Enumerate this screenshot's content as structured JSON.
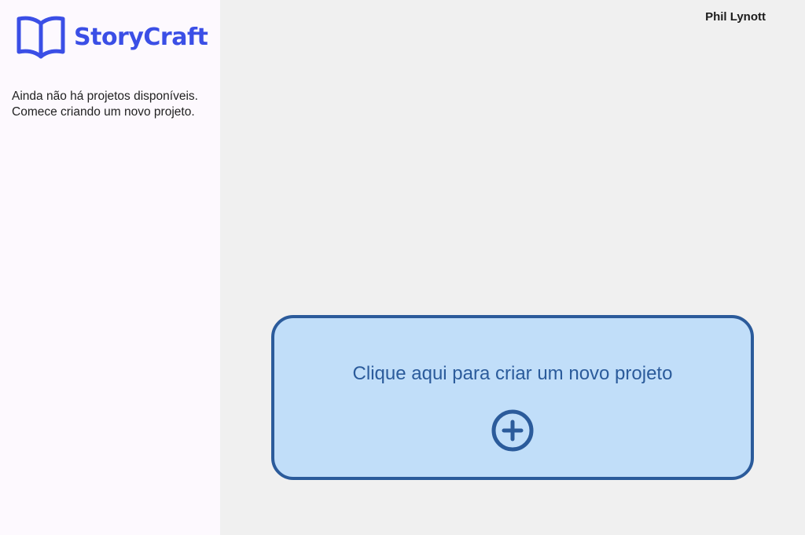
{
  "brand": {
    "name": "StoryCraft",
    "logo_icon": "open-book-icon",
    "color": "#3b4fe6"
  },
  "sidebar": {
    "empty_message_line1": "Ainda não há projetos disponíveis.",
    "empty_message_line2": "Comece criando um novo projeto."
  },
  "header": {
    "user_name": "Phil Lynott"
  },
  "main": {
    "new_project_card": {
      "label": "Clique aqui para criar um novo projeto",
      "icon": "plus-circle-icon",
      "background": "#c1def9",
      "accent": "#2b5b9b"
    }
  }
}
